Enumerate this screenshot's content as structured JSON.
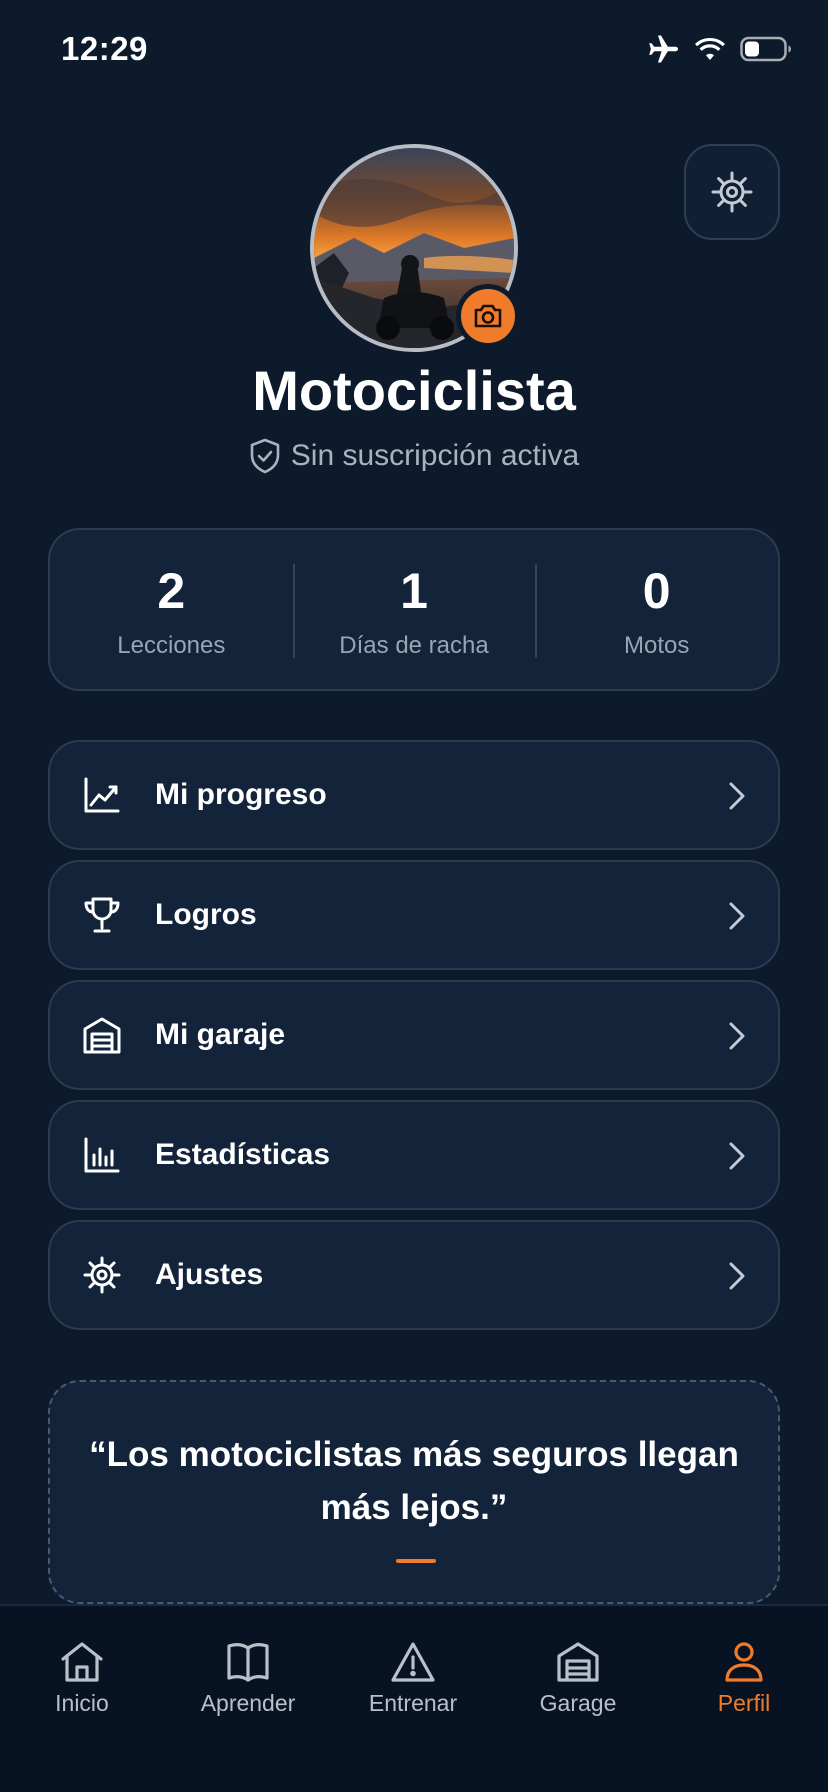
{
  "status_bar": {
    "time": "12:29"
  },
  "profile": {
    "name": "Motociclista",
    "subscription": "Sin suscripción activa"
  },
  "stats": [
    {
      "value": "2",
      "label": "Lecciones"
    },
    {
      "value": "1",
      "label": "Días de racha"
    },
    {
      "value": "0",
      "label": "Motos"
    }
  ],
  "menu": [
    {
      "label": "Mi progreso",
      "icon": "chart-line-icon"
    },
    {
      "label": "Logros",
      "icon": "trophy-icon"
    },
    {
      "label": "Mi garaje",
      "icon": "garage-icon"
    },
    {
      "label": "Estadísticas",
      "icon": "bar-chart-icon"
    },
    {
      "label": "Ajustes",
      "icon": "gear-icon"
    }
  ],
  "quote": {
    "text": "“Los motociclistas más seguros llegan más lejos.”"
  },
  "tabs": [
    {
      "label": "Inicio",
      "icon": "home-icon"
    },
    {
      "label": "Aprender",
      "icon": "book-icon"
    },
    {
      "label": "Entrenar",
      "icon": "warning-icon"
    },
    {
      "label": "Garage",
      "icon": "garage-icon"
    },
    {
      "label": "Perfil",
      "icon": "user-icon",
      "active": true
    }
  ],
  "colors": {
    "accent": "#f07b2b",
    "background": "#0c1a2b",
    "card": "#12233a"
  }
}
